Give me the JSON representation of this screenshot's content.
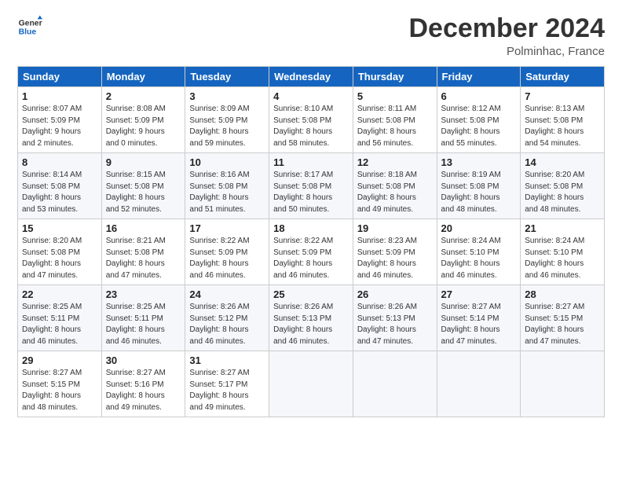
{
  "logo": {
    "line1": "General",
    "line2": "Blue"
  },
  "title": "December 2024",
  "subtitle": "Polminhac, France",
  "days_header": [
    "Sunday",
    "Monday",
    "Tuesday",
    "Wednesday",
    "Thursday",
    "Friday",
    "Saturday"
  ],
  "weeks": [
    [
      {
        "day": "1",
        "info": "Sunrise: 8:07 AM\nSunset: 5:09 PM\nDaylight: 9 hours\nand 2 minutes."
      },
      {
        "day": "2",
        "info": "Sunrise: 8:08 AM\nSunset: 5:09 PM\nDaylight: 9 hours\nand 0 minutes."
      },
      {
        "day": "3",
        "info": "Sunrise: 8:09 AM\nSunset: 5:09 PM\nDaylight: 8 hours\nand 59 minutes."
      },
      {
        "day": "4",
        "info": "Sunrise: 8:10 AM\nSunset: 5:08 PM\nDaylight: 8 hours\nand 58 minutes."
      },
      {
        "day": "5",
        "info": "Sunrise: 8:11 AM\nSunset: 5:08 PM\nDaylight: 8 hours\nand 56 minutes."
      },
      {
        "day": "6",
        "info": "Sunrise: 8:12 AM\nSunset: 5:08 PM\nDaylight: 8 hours\nand 55 minutes."
      },
      {
        "day": "7",
        "info": "Sunrise: 8:13 AM\nSunset: 5:08 PM\nDaylight: 8 hours\nand 54 minutes."
      }
    ],
    [
      {
        "day": "8",
        "info": "Sunrise: 8:14 AM\nSunset: 5:08 PM\nDaylight: 8 hours\nand 53 minutes."
      },
      {
        "day": "9",
        "info": "Sunrise: 8:15 AM\nSunset: 5:08 PM\nDaylight: 8 hours\nand 52 minutes."
      },
      {
        "day": "10",
        "info": "Sunrise: 8:16 AM\nSunset: 5:08 PM\nDaylight: 8 hours\nand 51 minutes."
      },
      {
        "day": "11",
        "info": "Sunrise: 8:17 AM\nSunset: 5:08 PM\nDaylight: 8 hours\nand 50 minutes."
      },
      {
        "day": "12",
        "info": "Sunrise: 8:18 AM\nSunset: 5:08 PM\nDaylight: 8 hours\nand 49 minutes."
      },
      {
        "day": "13",
        "info": "Sunrise: 8:19 AM\nSunset: 5:08 PM\nDaylight: 8 hours\nand 48 minutes."
      },
      {
        "day": "14",
        "info": "Sunrise: 8:20 AM\nSunset: 5:08 PM\nDaylight: 8 hours\nand 48 minutes."
      }
    ],
    [
      {
        "day": "15",
        "info": "Sunrise: 8:20 AM\nSunset: 5:08 PM\nDaylight: 8 hours\nand 47 minutes."
      },
      {
        "day": "16",
        "info": "Sunrise: 8:21 AM\nSunset: 5:08 PM\nDaylight: 8 hours\nand 47 minutes."
      },
      {
        "day": "17",
        "info": "Sunrise: 8:22 AM\nSunset: 5:09 PM\nDaylight: 8 hours\nand 46 minutes."
      },
      {
        "day": "18",
        "info": "Sunrise: 8:22 AM\nSunset: 5:09 PM\nDaylight: 8 hours\nand 46 minutes."
      },
      {
        "day": "19",
        "info": "Sunrise: 8:23 AM\nSunset: 5:09 PM\nDaylight: 8 hours\nand 46 minutes."
      },
      {
        "day": "20",
        "info": "Sunrise: 8:24 AM\nSunset: 5:10 PM\nDaylight: 8 hours\nand 46 minutes."
      },
      {
        "day": "21",
        "info": "Sunrise: 8:24 AM\nSunset: 5:10 PM\nDaylight: 8 hours\nand 46 minutes."
      }
    ],
    [
      {
        "day": "22",
        "info": "Sunrise: 8:25 AM\nSunset: 5:11 PM\nDaylight: 8 hours\nand 46 minutes."
      },
      {
        "day": "23",
        "info": "Sunrise: 8:25 AM\nSunset: 5:11 PM\nDaylight: 8 hours\nand 46 minutes."
      },
      {
        "day": "24",
        "info": "Sunrise: 8:26 AM\nSunset: 5:12 PM\nDaylight: 8 hours\nand 46 minutes."
      },
      {
        "day": "25",
        "info": "Sunrise: 8:26 AM\nSunset: 5:13 PM\nDaylight: 8 hours\nand 46 minutes."
      },
      {
        "day": "26",
        "info": "Sunrise: 8:26 AM\nSunset: 5:13 PM\nDaylight: 8 hours\nand 47 minutes."
      },
      {
        "day": "27",
        "info": "Sunrise: 8:27 AM\nSunset: 5:14 PM\nDaylight: 8 hours\nand 47 minutes."
      },
      {
        "day": "28",
        "info": "Sunrise: 8:27 AM\nSunset: 5:15 PM\nDaylight: 8 hours\nand 47 minutes."
      }
    ],
    [
      {
        "day": "29",
        "info": "Sunrise: 8:27 AM\nSunset: 5:15 PM\nDaylight: 8 hours\nand 48 minutes."
      },
      {
        "day": "30",
        "info": "Sunrise: 8:27 AM\nSunset: 5:16 PM\nDaylight: 8 hours\nand 49 minutes."
      },
      {
        "day": "31",
        "info": "Sunrise: 8:27 AM\nSunset: 5:17 PM\nDaylight: 8 hours\nand 49 minutes."
      },
      null,
      null,
      null,
      null
    ]
  ]
}
